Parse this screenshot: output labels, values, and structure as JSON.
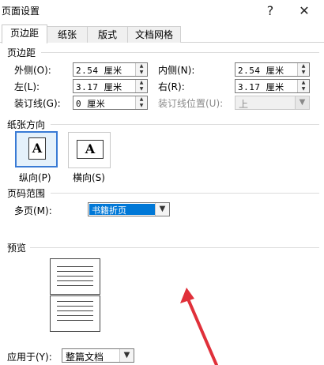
{
  "window": {
    "title": "页面设置",
    "help_symbol": "?",
    "close_symbol": "✕"
  },
  "tabs": [
    {
      "label": "页边距",
      "active": true
    },
    {
      "label": "纸张",
      "active": false
    },
    {
      "label": "版式",
      "active": false
    },
    {
      "label": "文档网格",
      "active": false
    }
  ],
  "margins": {
    "heading": "页边距",
    "outer_label": "外侧(O):",
    "outer_value": "2.54 厘米",
    "inner_label": "内侧(N):",
    "inner_value": "2.54 厘米",
    "left_label": "左(L):",
    "left_value": "3.17 厘米",
    "right_label": "右(R):",
    "right_value": "3.17 厘米",
    "gutter_label": "装订线(G):",
    "gutter_value": "0 厘米",
    "gutter_pos_label": "装订线位置(U):",
    "gutter_pos_value": "上"
  },
  "orientation": {
    "heading": "纸张方向",
    "portrait_label": "纵向(P)",
    "landscape_label": "横向(S)",
    "glyph": "A",
    "selected": "portrait"
  },
  "pages": {
    "heading": "页码范围",
    "multiple_label": "多页(M):",
    "multiple_value": "书籍折页"
  },
  "preview": {
    "heading": "预览"
  },
  "apply": {
    "label": "应用于(Y):",
    "value": "整篇文档"
  },
  "colors": {
    "accent": "#3a7bd5",
    "selection": "#0078d7",
    "arrow": "#e0303a"
  }
}
